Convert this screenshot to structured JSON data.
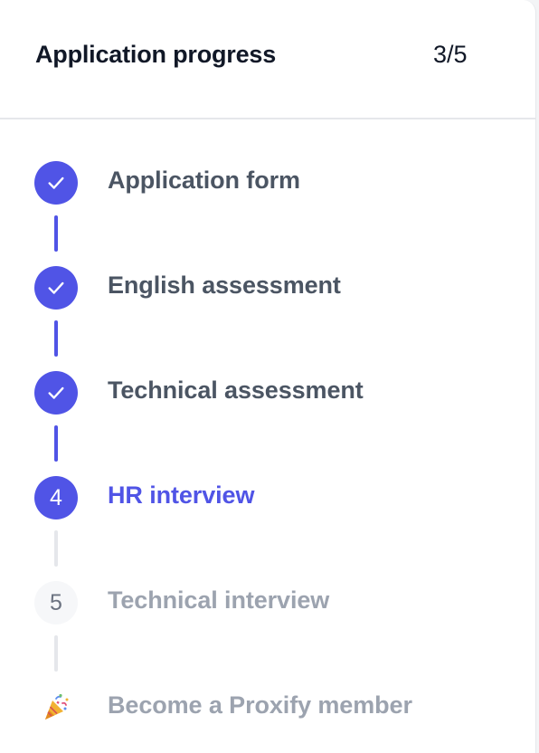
{
  "header": {
    "title": "Application progress",
    "count": "3/5"
  },
  "steps": [
    {
      "label": "Application form",
      "status": "done",
      "marker": ""
    },
    {
      "label": "English assessment",
      "status": "done",
      "marker": ""
    },
    {
      "label": "Technical assessment",
      "status": "done",
      "marker": ""
    },
    {
      "label": "HR interview",
      "status": "current",
      "marker": "4"
    },
    {
      "label": "Technical interview",
      "status": "pending",
      "marker": "5"
    },
    {
      "label": "Become a Proxify member",
      "status": "pending",
      "marker": "🎉"
    }
  ],
  "colors": {
    "accent": "#5054e6",
    "done_text": "#4b5563",
    "pending_text": "#9ca3af"
  }
}
